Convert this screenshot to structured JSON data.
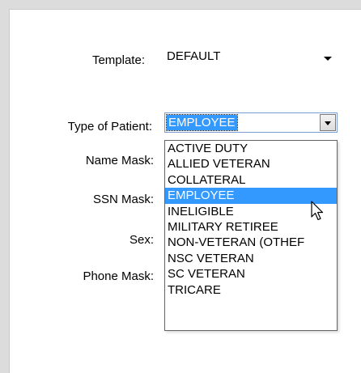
{
  "form": {
    "template_label": "Template:",
    "template_value": "DEFAULT",
    "patient_type_label": "Type of Patient:",
    "patient_type_value": "EMPLOYEE",
    "name_mask_label": "Name Mask:",
    "ssn_mask_label": "SSN Mask:",
    "sex_label": "Sex:",
    "phone_mask_label": "Phone Mask:"
  },
  "dropdown": {
    "selected_index": 3,
    "items": [
      "ACTIVE DUTY",
      "ALLIED VETERAN",
      "COLLATERAL",
      "EMPLOYEE",
      "INELIGIBLE",
      "MILITARY RETIREE",
      "NON-VETERAN (OTHEF",
      "NSC VETERAN",
      "SC VETERAN",
      "TRICARE"
    ]
  },
  "colors": {
    "selection": "#3399ff",
    "frame": "#dcdcdc"
  },
  "icons": {
    "cursor": "arrow-cursor-icon",
    "dropdown_arrow": "chevron-down-icon"
  }
}
